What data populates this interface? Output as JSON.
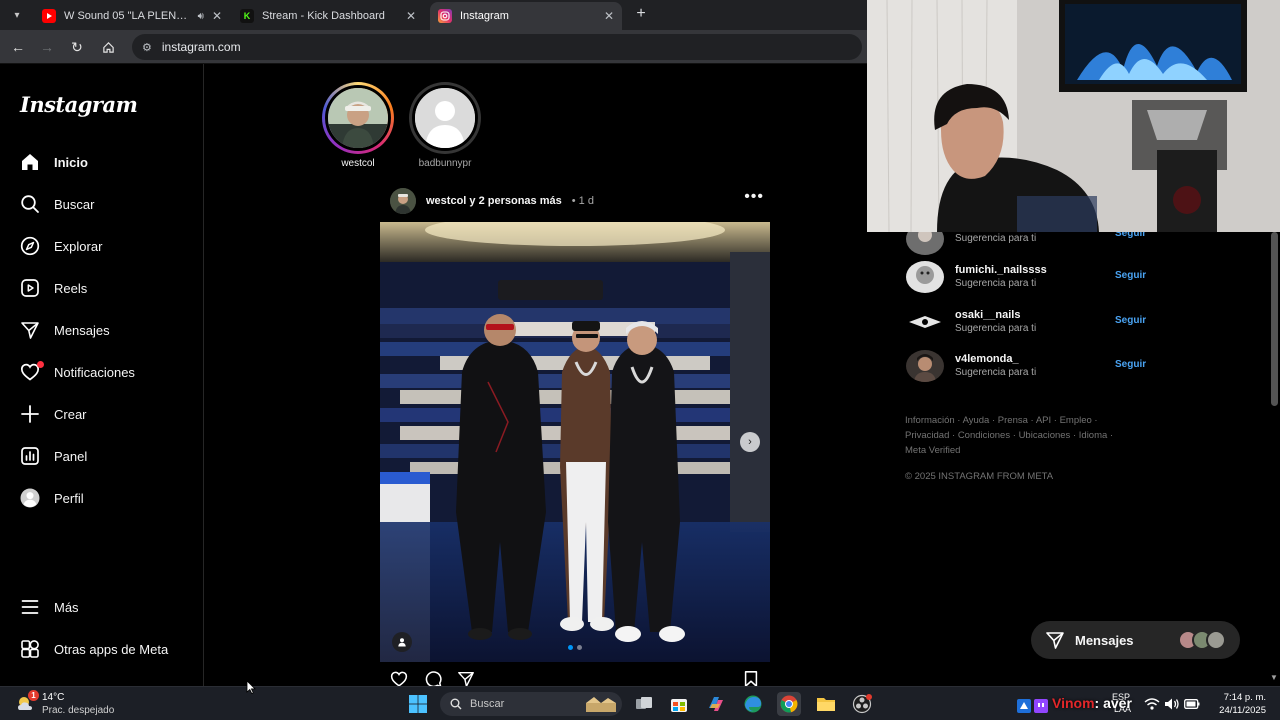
{
  "browser": {
    "tabs": [
      {
        "title": "W Sound 05 \"LA PLENA\" - B",
        "favicon_color": "#ff0000",
        "active": false,
        "has_audio": true
      },
      {
        "title": "Stream - Kick Dashboard",
        "favicon_color": "#53fc18",
        "favicon_letter": "K",
        "active": false
      },
      {
        "title": "Instagram",
        "favicon_color": "#e1306c",
        "active": true
      }
    ],
    "url": "instagram.com"
  },
  "instagram": {
    "logo": "Instagram",
    "nav": [
      {
        "label": "Inicio",
        "icon": "home-icon",
        "bold": true
      },
      {
        "label": "Buscar",
        "icon": "search-icon"
      },
      {
        "label": "Explorar",
        "icon": "compass-icon"
      },
      {
        "label": "Reels",
        "icon": "reels-icon"
      },
      {
        "label": "Mensajes",
        "icon": "send-icon"
      },
      {
        "label": "Notificaciones",
        "icon": "heart-icon",
        "has_dot": true
      },
      {
        "label": "Crear",
        "icon": "plus-icon"
      },
      {
        "label": "Panel",
        "icon": "chart-icon"
      },
      {
        "label": "Perfil",
        "icon": "profile-avatar"
      }
    ],
    "more": {
      "label": "Más",
      "icon": "menu-icon"
    },
    "meta_apps": {
      "label": "Otras apps de Meta",
      "icon": "meta-apps-icon"
    },
    "stories": [
      {
        "name": "westcol",
        "seen": false
      },
      {
        "name": "badbunnypr",
        "seen": true
      }
    ],
    "post": {
      "user": "westcol y 2 personas más",
      "separator": "•",
      "time": "1 d",
      "more": "•••",
      "carousel_count": 2,
      "carousel_index": 1
    },
    "suggestions": [
      {
        "username": "",
        "subtitle": "Sugerencia para ti",
        "action": "Seguir"
      },
      {
        "username": "fumichi._nailssss",
        "subtitle": "Sugerencia para ti",
        "action": "Seguir"
      },
      {
        "username": "osaki__nails",
        "subtitle": "Sugerencia para ti",
        "action": "Seguir"
      },
      {
        "username": "v4lemonda_",
        "subtitle": "Sugerencia para ti",
        "action": "Seguir"
      }
    ],
    "footer_links": [
      "Información",
      "Ayuda",
      "Prensa",
      "API",
      "Empleo",
      "Privacidad",
      "Condiciones",
      "Ubicaciones",
      "Idioma",
      "Meta Verified"
    ],
    "footer_sep": " · ",
    "copyright": "© 2025 INSTAGRAM FROM META",
    "messages_pill": {
      "label": "Mensajes"
    }
  },
  "taskbar": {
    "weather": {
      "temp": "14°C",
      "condition": "Prac. despejado",
      "badge": "1"
    },
    "search_placeholder": "Buscar",
    "language": "ESP",
    "language_sub": "LAA",
    "time": "7:14 p. m.",
    "date": "24/11/2025"
  },
  "stream_overlay": {
    "prefix": "Vinom",
    "text": ": aver"
  },
  "colors": {
    "accent_link": "#4aa3f2",
    "notification": "#ff3040",
    "background": "#000000"
  }
}
